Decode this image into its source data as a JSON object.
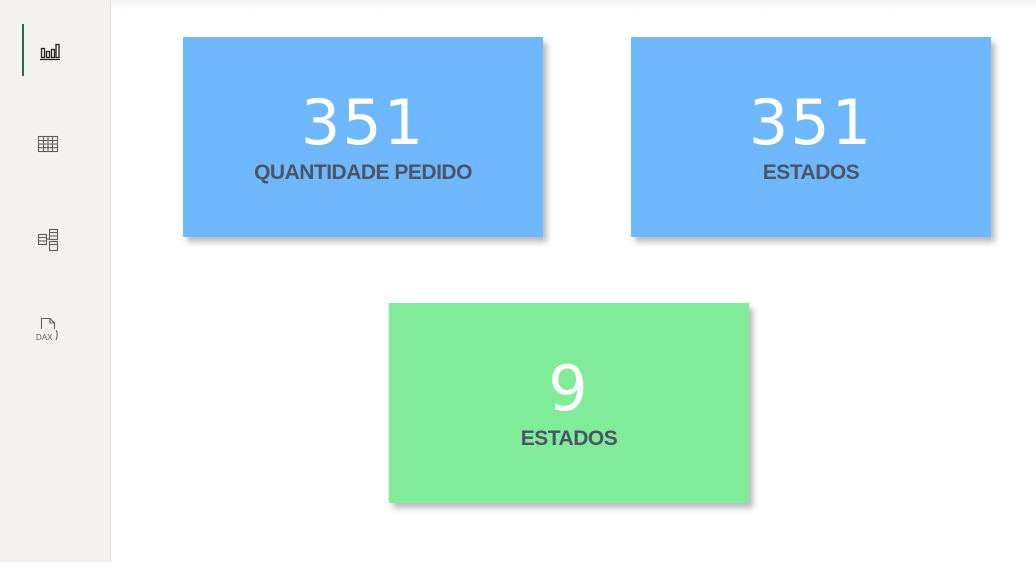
{
  "sidebar": {
    "items": [
      {
        "icon": "report-view-icon",
        "active": true
      },
      {
        "icon": "table-view-icon",
        "active": false
      },
      {
        "icon": "model-view-icon",
        "active": false
      },
      {
        "icon": "dax-query-icon",
        "active": false,
        "icon_text": "DAX"
      }
    ]
  },
  "cards": [
    {
      "value": "351",
      "label": "QUANTIDADE PEDIDO",
      "color": "#6fb8fe"
    },
    {
      "value": "351",
      "label": "ESTADOS",
      "color": "#6fb8fe"
    },
    {
      "value": "9",
      "label": "ESTADOS",
      "color": "#80ec9a"
    }
  ],
  "colors": {
    "sidebar_bg": "#f3f2f1",
    "active_indicator": "#217346",
    "card_blue": "#6fb8fe",
    "card_green": "#80ec9a",
    "label_text": "#4b5566",
    "value_text": "#ffffff"
  }
}
